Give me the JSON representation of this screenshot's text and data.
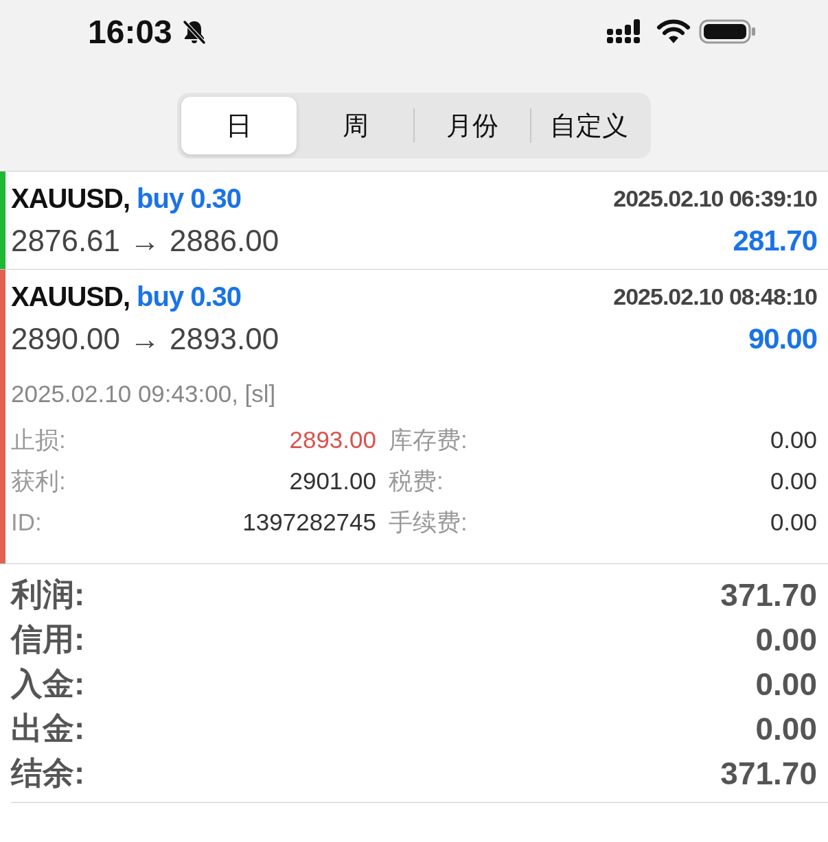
{
  "status_bar": {
    "time": "16:03"
  },
  "tabs": [
    {
      "label": "日",
      "selected": true
    },
    {
      "label": "周",
      "selected": false
    },
    {
      "label": "月份",
      "selected": false
    },
    {
      "label": "自定义",
      "selected": false
    }
  ],
  "trades": [
    {
      "symbol": "XAUUSD,",
      "side": "buy 0.30",
      "time": "2025.02.10 06:39:10",
      "open_price": "2876.61",
      "arrow": "→",
      "close_price": "2886.00",
      "profit": "281.70",
      "color": "#1fb835",
      "expanded": false
    },
    {
      "symbol": "XAUUSD,",
      "side": "buy 0.30",
      "time": "2025.02.10 08:48:10",
      "open_price": "2890.00",
      "arrow": "→",
      "close_price": "2893.00",
      "profit": "90.00",
      "color": "#e2604f",
      "expanded": true,
      "close_info": "2025.02.10 09:43:00, [sl]",
      "details": [
        {
          "label": "止损:",
          "value": "2893.00",
          "highlight": true,
          "label2": "库存费:",
          "value2": "0.00"
        },
        {
          "label": "获利:",
          "value": "2901.00",
          "highlight": false,
          "label2": "税费:",
          "value2": "0.00"
        },
        {
          "label": "ID:",
          "value": "1397282745",
          "highlight": false,
          "label2": "手续费:",
          "value2": "0.00"
        }
      ]
    }
  ],
  "summary": [
    {
      "label": "利润:",
      "value": "371.70"
    },
    {
      "label": "信用:",
      "value": "0.00"
    },
    {
      "label": "入金:",
      "value": "0.00"
    },
    {
      "label": "出金:",
      "value": "0.00"
    },
    {
      "label": "结余:",
      "value": "371.70"
    }
  ]
}
